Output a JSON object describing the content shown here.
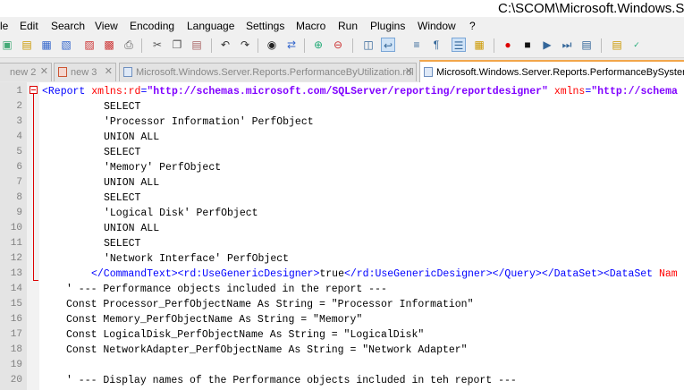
{
  "window": {
    "title": "C:\\SCOM\\Microsoft.Windows.Se"
  },
  "menu": [
    "le",
    "Edit",
    "Search",
    "View",
    "Encoding",
    "Language",
    "Settings",
    "Macro",
    "Run",
    "Plugins",
    "Window",
    "?"
  ],
  "tabs": [
    {
      "label": "new  2",
      "close": "✕",
      "active": false
    },
    {
      "label": "new  3",
      "close": "✕",
      "active": false
    },
    {
      "label": "Microsoft.Windows.Server.Reports.PerformanceByUtilization.rdl",
      "close": "✕",
      "active": false
    },
    {
      "label": "Microsoft.Windows.Server.Reports.PerformanceBySystem_",
      "close": "",
      "active": true
    }
  ],
  "editor": {
    "line_numbers": [
      "1",
      "2",
      "3",
      "4",
      "5",
      "6",
      "7",
      "8",
      "9",
      "10",
      "11",
      "12",
      "13",
      "14",
      "15",
      "16",
      "17",
      "18",
      "19",
      "20"
    ],
    "line1": {
      "tag_open": "<Report",
      "attr1": " xmlns:rd",
      "eq1": "=",
      "val1": "\"http://schemas.microsoft.com/SQLServer/reporting/reportdesigner\"",
      "attr2": " xmlns",
      "eq2": "=",
      "val2": "\"http://schema"
    },
    "sql_lines": [
      "SELECT",
      "'Processor Information' PerfObject",
      "UNION ALL",
      "SELECT",
      "'Memory' PerfObject",
      "UNION ALL",
      "SELECT",
      "'Logical Disk' PerfObject",
      "UNION ALL",
      "SELECT",
      "'Network Interface' PerfObject"
    ],
    "line13": {
      "close_cmd": "</CommandText>",
      "open_ugd": "<rd:UseGenericDesigner>",
      "text": "true",
      "close_ugd": "</rd:UseGenericDesigner>",
      "close_query": "</Query>",
      "close_dataset": "</DataSet>",
      "open_dataset": "<DataSet",
      "attr": " Nam"
    },
    "vb_lines": [
      "' --- Performance objects included in the report ---",
      "Const Processor_PerfObjectName As String = \"Processor Information\"",
      "Const Memory_PerfObjectName As String = \"Memory\"",
      "Const LogicalDisk_PerfObjectName As String = \"LogicalDisk\"",
      "Const NetworkAdapter_PerfObjectName As String = \"Network Adapter\"",
      "",
      "' --- Display names of the Performance objects included in teh report ---"
    ]
  }
}
